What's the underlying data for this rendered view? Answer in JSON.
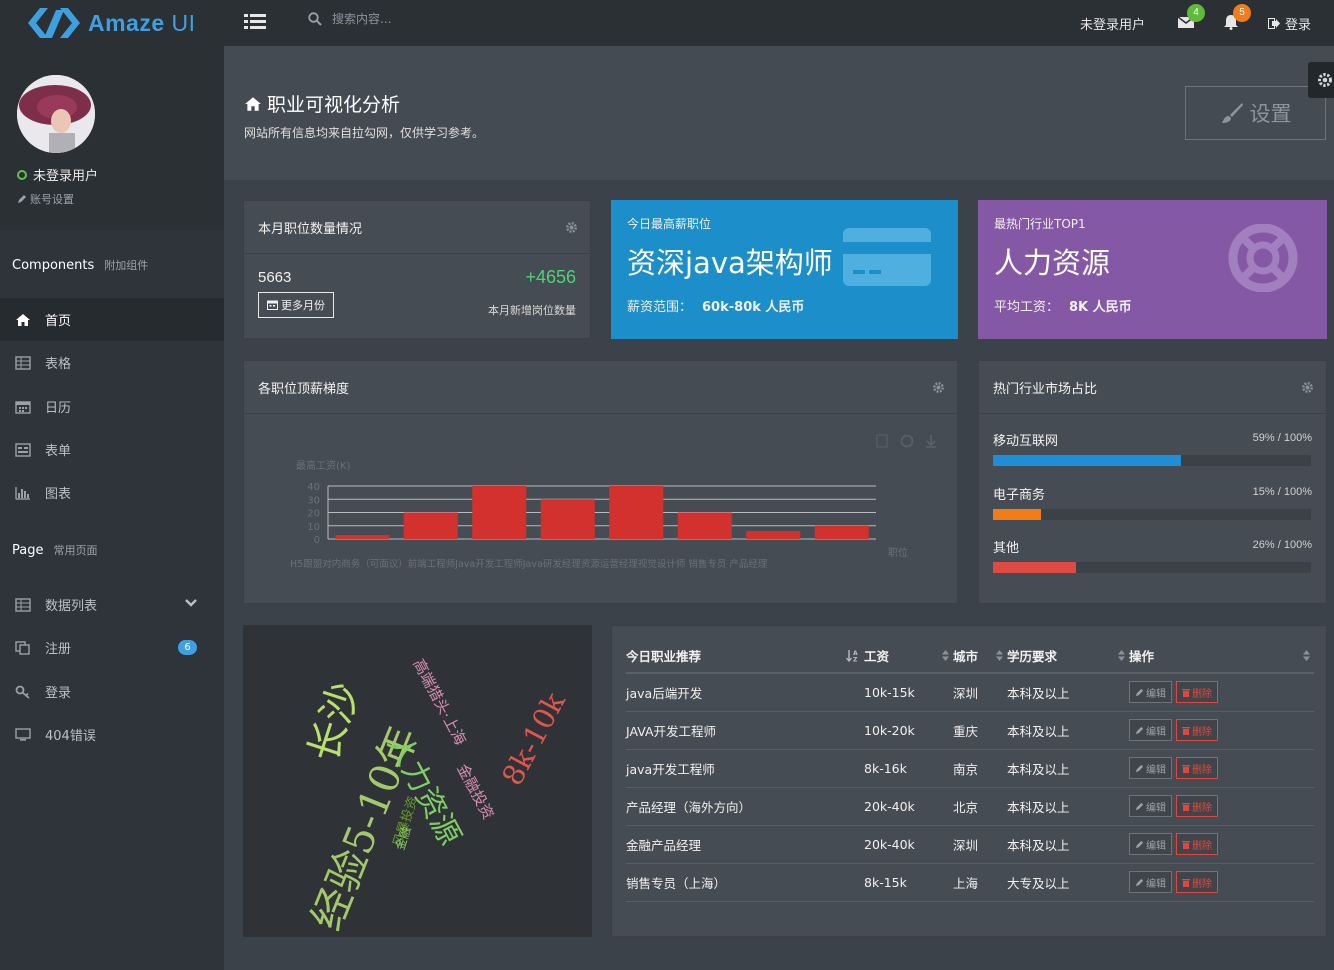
{
  "header": {
    "brand_main": "Amaze",
    "brand_thin": " UI",
    "search_placeholder": "搜索内容...",
    "user_label": "未登录用户",
    "mail_badge": "4",
    "bell_badge": "5",
    "login_label": "登录",
    "colors": {
      "brand": "#3fa0e0",
      "mail_badge": "#5fba3a",
      "bell_badge": "#f07d1a"
    }
  },
  "sidebar": {
    "status_label": "未登录用户",
    "account_settings": "账号设置",
    "components_title": "Components",
    "components_sub": "附加组件",
    "page_title": "Page",
    "page_sub": "常用页面",
    "items": [
      {
        "label": "首页",
        "icon": "home-icon"
      },
      {
        "label": "表格",
        "icon": "table-icon"
      },
      {
        "label": "日历",
        "icon": "calendar-icon"
      },
      {
        "label": "表单",
        "icon": "form-icon"
      },
      {
        "label": "图表",
        "icon": "bar-chart-icon"
      }
    ],
    "page_items": [
      {
        "label": "数据列表",
        "icon": "table-icon"
      },
      {
        "label": "注册",
        "icon": "clone-icon",
        "badge": "6"
      },
      {
        "label": "登录",
        "icon": "key-icon"
      },
      {
        "label": "404错误",
        "icon": "monitor-icon"
      }
    ]
  },
  "main": {
    "title": "职业可视化分析",
    "subtitle": "网站所有信息均来自拉勾网，仅供学习参考。",
    "settings_label": "设置"
  },
  "monthly": {
    "header": "本月职位数量情况",
    "count": "5663",
    "delta": "+4656",
    "more_label": "更多月份",
    "note": "本月新增岗位数量"
  },
  "tile_salary": {
    "caption": "今日最高薪职位",
    "title": "资深java架构师",
    "sub_label": "薪资范围：",
    "sub_value": "60k-80k 人民币",
    "color": "#1c8ec9"
  },
  "tile_industry": {
    "caption": "最热门行业TOP1",
    "title": "人力资源",
    "sub_label": "平均工资：",
    "sub_value": "8K 人民币",
    "color": "#8558a6"
  },
  "salary_panel": {
    "header": "各职位顶薪梯度"
  },
  "chart_data": {
    "type": "bar",
    "title": "",
    "ylabel": "最高工资(K)",
    "xlabel": "职位",
    "ylim": [
      0,
      40
    ],
    "yticks": [
      0,
      10,
      20,
      30,
      40
    ],
    "categories": [
      "H5跟盟对内商务（可面议）",
      "前端工程师",
      "Java开发工程师",
      "Java研发经理",
      "资源运营经理",
      "视觉设计师",
      "销售专员",
      "产品经理"
    ],
    "category_display": "H5跟盟对内商务（可面议）前端工程师Java开发工程师Java研发经理资源运营经理视觉设计师   销售专员          产品经理",
    "values": [
      3,
      20,
      40,
      30,
      40,
      20,
      6,
      10
    ],
    "color": "#d3312e",
    "grid": true
  },
  "market_panel": {
    "header": "热门行业市场占比",
    "rows": [
      {
        "label": "移动互联网",
        "pct_text": "59% / 100%",
        "value": 59,
        "color": "#1e8fd6"
      },
      {
        "label": "电子商务",
        "pct_text": "15% / 100%",
        "value": 15,
        "color": "#f07d1a"
      },
      {
        "label": "其他",
        "pct_text": "26% / 100%",
        "value": 26,
        "color": "#e04a45"
      }
    ]
  },
  "wordcloud": {
    "words": [
      {
        "text": "长沙",
        "color": "#b9e06b"
      },
      {
        "text": "经验5-10年",
        "color": "#a4c96a"
      },
      {
        "text": "人力资源",
        "color": "#7fcf64"
      },
      {
        "text": "风暴投资",
        "color": "#6b9c2a"
      },
      {
        "text": "高端猎头·上海",
        "color": "#d98fb0"
      },
      {
        "text": "金融投资",
        "color": "#d98fb0"
      },
      {
        "text": "8k-10k",
        "color": "#e0564c"
      },
      {
        "text": "金融",
        "color": "#8ac960"
      }
    ]
  },
  "jobs_table": {
    "columns": [
      "今日职业推荐",
      "工资",
      "城市",
      "学历要求",
      "操作"
    ],
    "edit_label": "编辑",
    "delete_label": "删除",
    "rows": [
      {
        "title": "java后端开发",
        "salary": "10k-15k",
        "city": "深圳",
        "edu": "本科及以上"
      },
      {
        "title": "JAVA开发工程师",
        "salary": "10k-20k",
        "city": "重庆",
        "edu": "本科及以上"
      },
      {
        "title": "java开发工程师",
        "salary": "8k-16k",
        "city": "南京",
        "edu": "本科及以上"
      },
      {
        "title": "产品经理（海外方向）",
        "salary": "20k-40k",
        "city": "北京",
        "edu": "本科及以上"
      },
      {
        "title": "金融产品经理",
        "salary": "20k-40k",
        "city": "深圳",
        "edu": "本科及以上"
      },
      {
        "title": "销售专员（上海）",
        "salary": "8k-15k",
        "city": "上海",
        "edu": "大专及以上"
      }
    ]
  }
}
